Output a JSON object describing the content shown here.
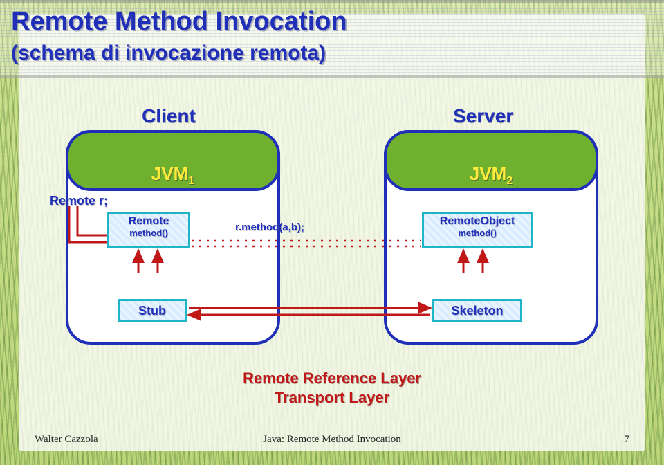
{
  "title": "Remote Method Invocation",
  "subtitle": "(schema di invocazione remota)",
  "client_label": "Client",
  "server_label": "Server",
  "jvm1": "JVM",
  "jvm1_sub": "1",
  "jvm2": "JVM",
  "jvm2_sub": "2",
  "remote_r": "Remote r;",
  "remote_box": "Remote",
  "method_label": "method()",
  "call_label": "r.method(a,b);",
  "remoteobj_box": "RemoteObject",
  "stub": "Stub",
  "skeleton": "Skeleton",
  "ref_layer": "Remote Reference Layer",
  "trans_layer": "Transport Layer",
  "footer_left": "Walter Cazzola",
  "footer_mid": "Java: Remote Method Invocation",
  "footer_right": "7"
}
